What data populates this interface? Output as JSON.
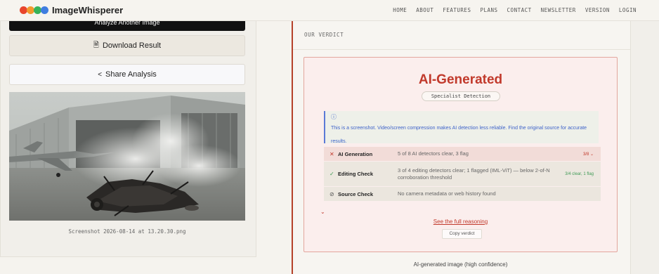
{
  "app": {
    "name": "ImageWhisperer",
    "dot_colors": [
      "#e8452c",
      "#f29a2e",
      "#36b35a",
      "#3f7de0"
    ]
  },
  "nav": [
    "HOME",
    "ABOUT",
    "FEATURES",
    "PLANS",
    "CONTACT",
    "NEWSLETTER",
    "VERSION",
    "LOGIN"
  ],
  "left": {
    "analyze_another_label": "Analyze Another Image",
    "download_label": "Download Result",
    "download_icon": "file-icon",
    "share_label": "Share Analysis",
    "share_icon": "share-icon",
    "image_caption": "Screenshot 2026-08-14 at 13.20.30.png"
  },
  "verdict": {
    "section_label": "OUR VERDICT",
    "title": "AI-Generated",
    "badge": "Specialist Detection",
    "alert_icon": "info-icon",
    "alert_text": "This is a screenshot. Video/screen compression makes AI detection less reliable. Find the original source for accurate results.",
    "checks": [
      {
        "icon": "✕",
        "icon_name": "x-icon",
        "icon_color": "#c1392b",
        "label": "AI Generation",
        "detail": "5 of 8 AI detectors clear, 3 flag",
        "score": "3/8 ⌄",
        "score_color": "#c1392b"
      },
      {
        "icon": "✓",
        "icon_name": "check-icon",
        "icon_color": "#3f9a55",
        "label": "Editing Check",
        "detail": "3 of 4 editing detectors clear; 1 flagged (IML-ViT) — below 2-of-N corroboration threshold",
        "score": "3/4 clear, 1 flag",
        "score_color": "#3f9a55"
      },
      {
        "icon": "⃠",
        "icon_name": "prohibited-icon",
        "icon_color": "#555",
        "label": "Source Check",
        "detail": "No camera metadata or web history found",
        "score": "",
        "score_color": "#555"
      }
    ],
    "expand_icon": "chevron-down-icon",
    "reasoning_link": "See the full reasoning",
    "copy_label": "Copy verdict",
    "summary": "AI-generated image (high confidence)"
  },
  "colors": {
    "accent": "#c1392b",
    "info": "#3f63c9"
  }
}
